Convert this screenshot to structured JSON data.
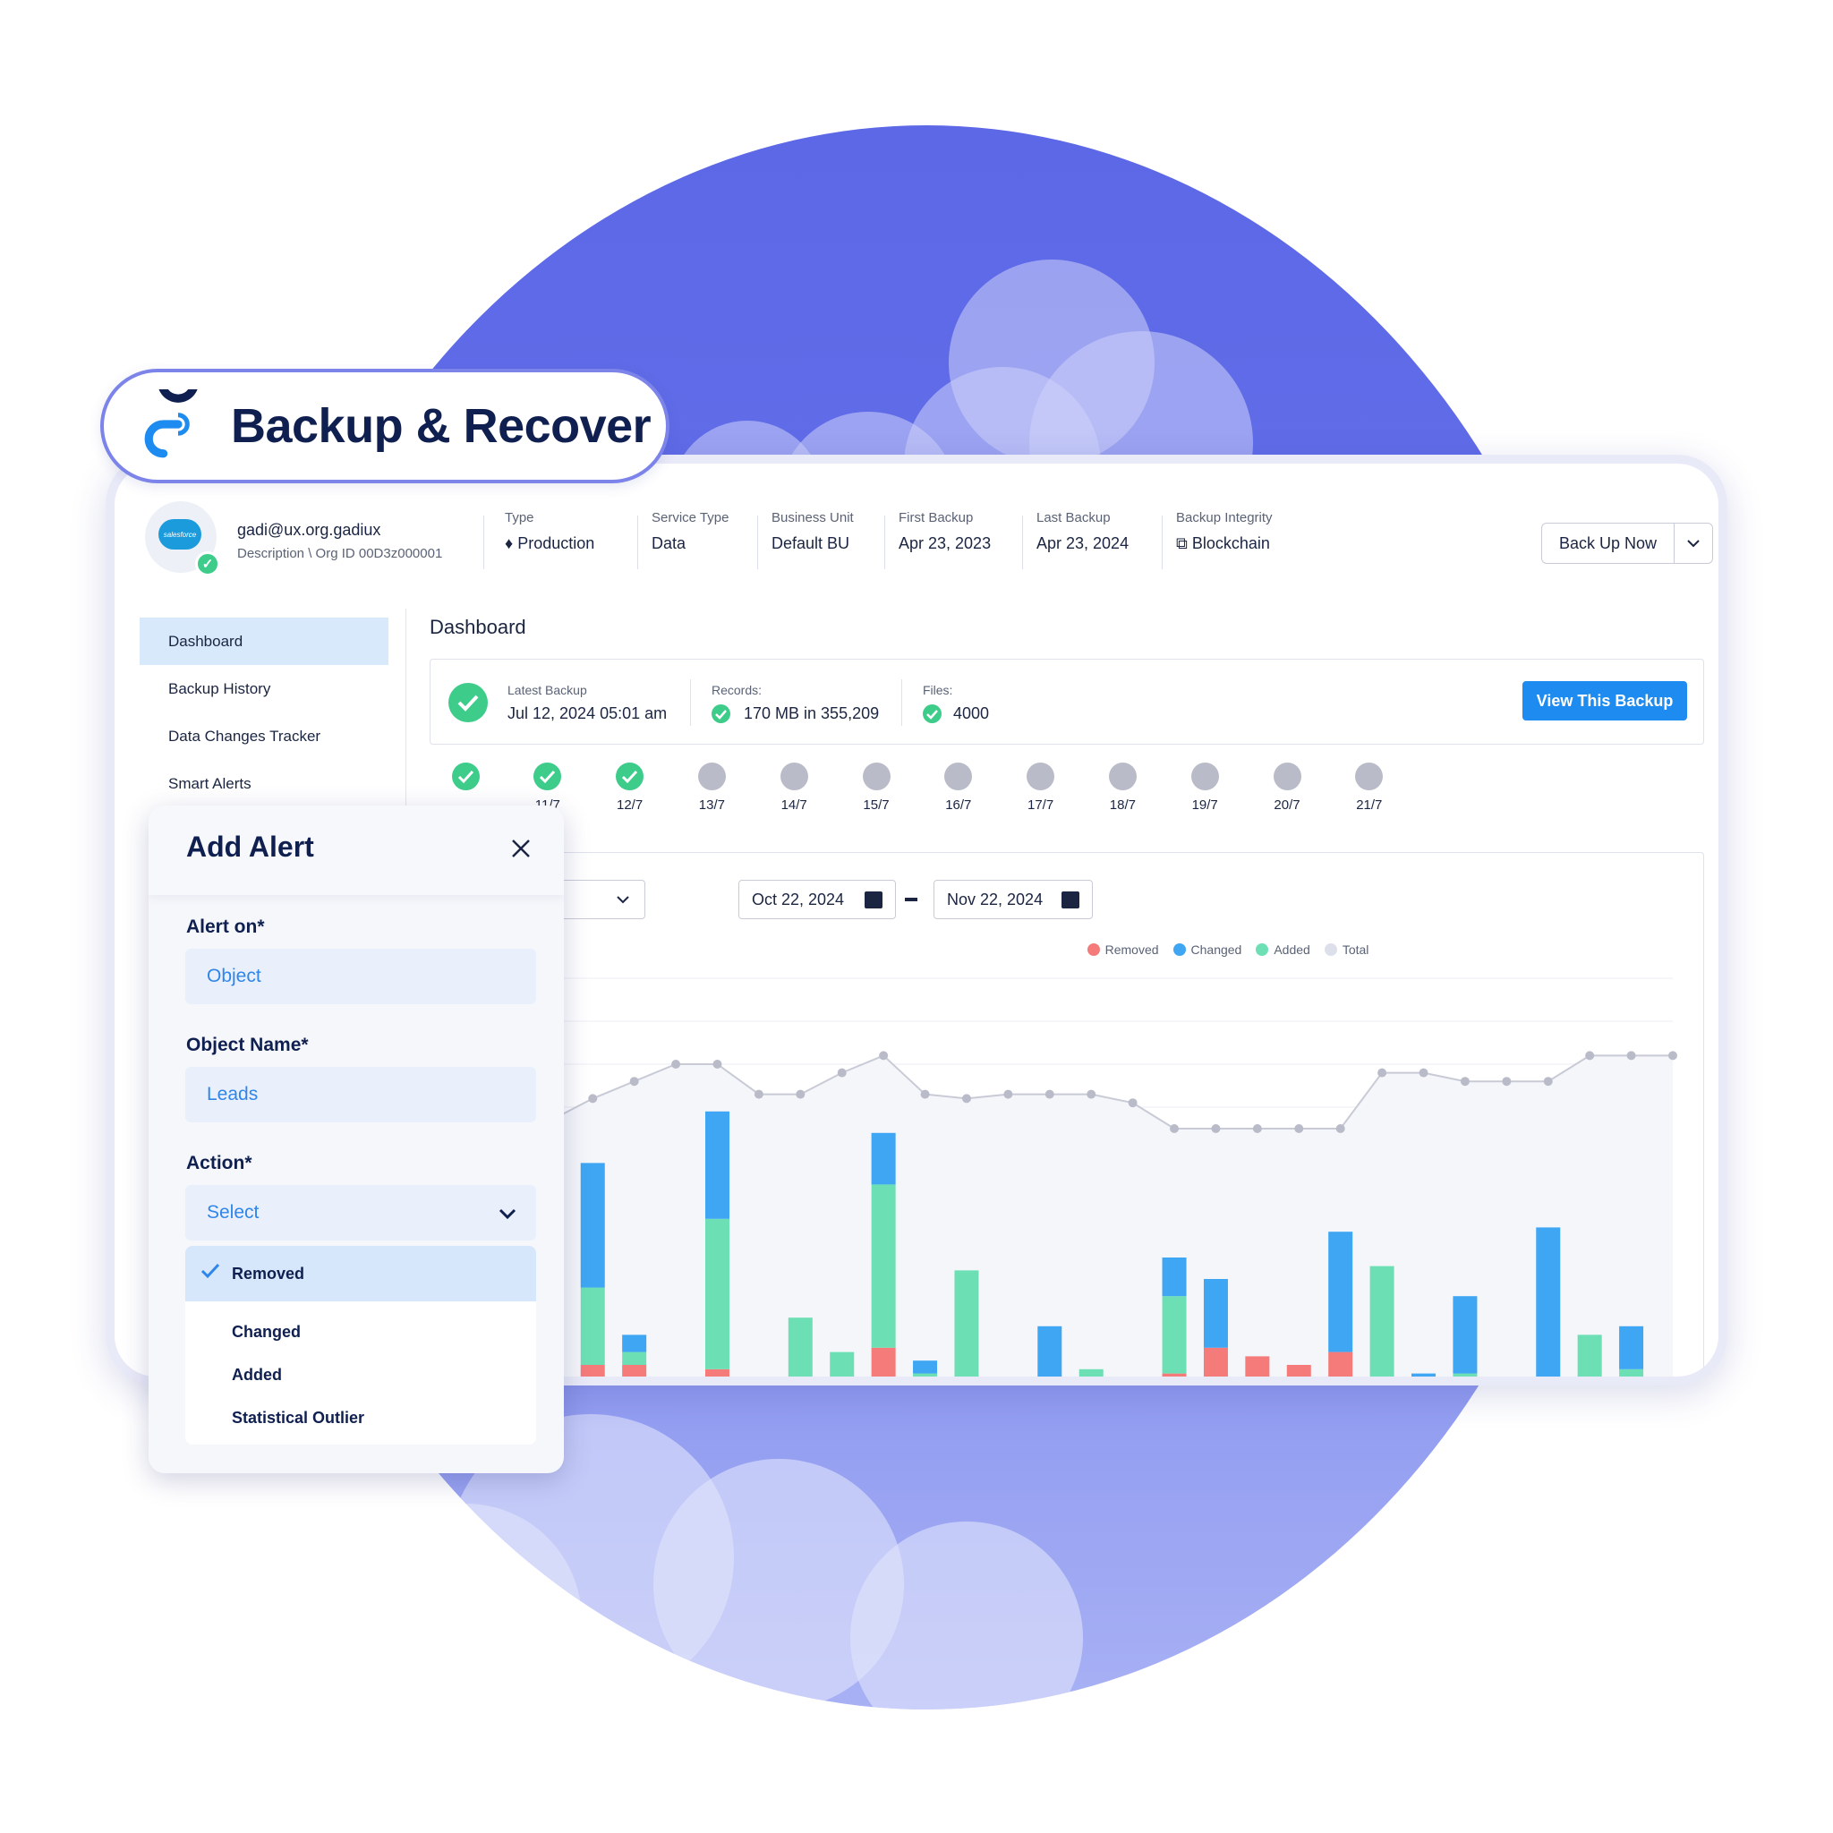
{
  "brand": {
    "name": "Backup & Recover",
    "colors": {
      "accent": "#1d8bf0",
      "success": "#3dcc8a",
      "navy": "#0f2050",
      "circle": "#5c68e6"
    }
  },
  "account": {
    "email": "gadi@ux.org.gadiux",
    "description": "Description \\ Org ID 00D3z000001",
    "logo_text": "salesforce"
  },
  "meta": [
    {
      "label": "Type",
      "value": "Production",
      "icon": "diamond-icon"
    },
    {
      "label": "Service Type",
      "value": "Data"
    },
    {
      "label": "Business Unit",
      "value": "Default BU"
    },
    {
      "label": "First Backup",
      "value": "Apr 23, 2023"
    },
    {
      "label": "Last Backup",
      "value": "Apr 23, 2024"
    },
    {
      "label": "Backup Integrity",
      "value": "Blockchain",
      "icon": "blockchain-icon"
    }
  ],
  "actions": {
    "backup_now": "Back Up Now"
  },
  "nav": [
    {
      "label": "Dashboard",
      "active": true
    },
    {
      "label": "Backup History"
    },
    {
      "label": "Data Changes Tracker"
    },
    {
      "label": "Smart Alerts"
    }
  ],
  "dashboard": {
    "title": "Dashboard",
    "latest_backup_label": "Latest Backup",
    "latest_backup_value": "Jul 12, 2024 05:01 am",
    "records_label": "Records:",
    "records_value": "170 MB in 355,209",
    "files_label": "Files:",
    "files_value": "4000",
    "view_button": "View This Backup"
  },
  "timeline": [
    {
      "label": "",
      "status": "ok"
    },
    {
      "label": "11/7",
      "status": "ok"
    },
    {
      "label": "12/7",
      "status": "ok"
    },
    {
      "label": "13/7",
      "status": "pending"
    },
    {
      "label": "14/7",
      "status": "pending"
    },
    {
      "label": "15/7",
      "status": "pending"
    },
    {
      "label": "16/7",
      "status": "pending"
    },
    {
      "label": "17/7",
      "status": "pending"
    },
    {
      "label": "18/7",
      "status": "pending"
    },
    {
      "label": "19/7",
      "status": "pending"
    },
    {
      "label": "20/7",
      "status": "pending"
    },
    {
      "label": "21/7",
      "status": "pending"
    }
  ],
  "filters": {
    "date_from": "Oct 22, 2024",
    "date_to": "Nov 22, 2024"
  },
  "chart_data": {
    "type": "bar",
    "stacked": true,
    "series_colors": {
      "Removed": "#f57b7b",
      "Changed": "#3ea6f2",
      "Added": "#6ce0b4",
      "Total": "#dde0ea"
    },
    "series": [
      {
        "name": "Removed",
        "values": [
          0,
          0,
          10,
          10,
          10,
          3,
          9,
          0,
          0,
          3,
          14,
          5,
          0,
          0,
          0,
          0,
          0,
          8,
          14,
          12,
          10,
          13,
          0,
          0,
          5,
          0,
          7,
          0,
          0,
          0
        ]
      },
      {
        "name": "Changed",
        "values": [
          0,
          0,
          14,
          29,
          4,
          4,
          25,
          6,
          0,
          0,
          12,
          3,
          0,
          0,
          19,
          0,
          0,
          9,
          16,
          0,
          0,
          28,
          0,
          8,
          18,
          0,
          35,
          0,
          10,
          0
        ]
      },
      {
        "name": "Added",
        "values": [
          0,
          21,
          20,
          18,
          3,
          0,
          35,
          0,
          21,
          10,
          38,
          3,
          32,
          0,
          0,
          9,
          0,
          18,
          0,
          0,
          0,
          0,
          33,
          0,
          3,
          0,
          0,
          17,
          9,
          5
        ]
      },
      {
        "name": "Total",
        "values": [
          62,
          64,
          67,
          72,
          76,
          80,
          80,
          73,
          73,
          78,
          82,
          73,
          72,
          73,
          73,
          73,
          71,
          65,
          65,
          65,
          65,
          65,
          78,
          78,
          76,
          76,
          76,
          82,
          82,
          82
        ]
      }
    ],
    "legend": [
      "Removed",
      "Changed",
      "Added",
      "Total"
    ],
    "legend_position": "top",
    "ylim": [
      0,
      100
    ],
    "grid": true
  },
  "add_alert": {
    "title": "Add Alert",
    "alert_on_label": "Alert on*",
    "alert_on_value": "Object",
    "object_name_label": "Object Name*",
    "object_name_value": "Leads",
    "action_label": "Action*",
    "action_value": "Select",
    "options": [
      "Removed",
      "Changed",
      "Added",
      "Statistical Outlier"
    ],
    "selected": "Removed"
  }
}
